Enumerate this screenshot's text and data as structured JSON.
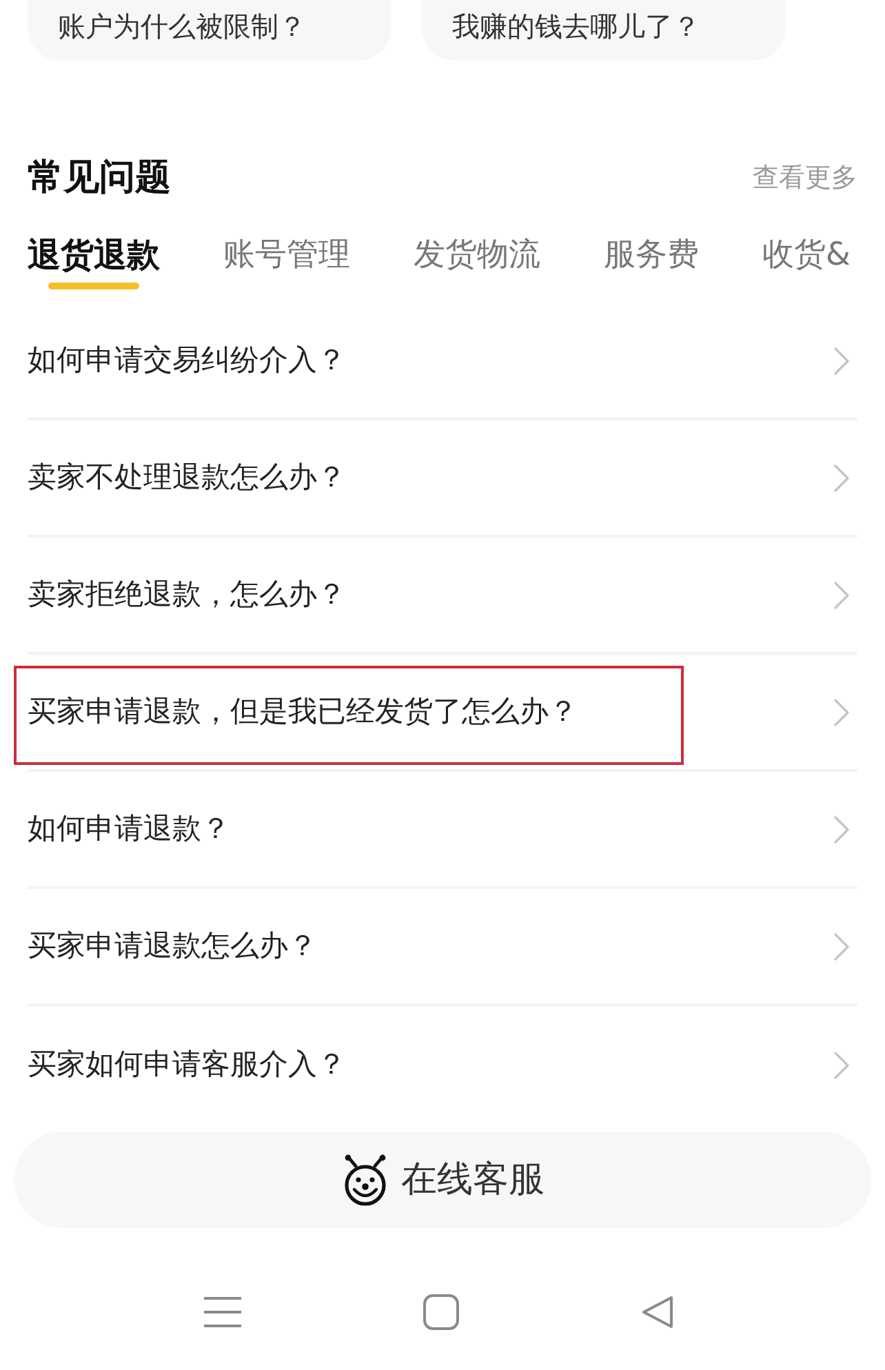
{
  "top_cards": [
    {
      "text": "账户为什么被限制？"
    },
    {
      "text": "我赚的钱去哪儿了？"
    }
  ],
  "faq": {
    "title": "常见问题",
    "more_link": "查看更多",
    "tabs": [
      {
        "label": "退货退款",
        "selected": true
      },
      {
        "label": "账号管理",
        "selected": false
      },
      {
        "label": "发货物流",
        "selected": false
      },
      {
        "label": "服务费",
        "selected": false
      },
      {
        "label": "收货&",
        "selected": false
      }
    ],
    "items": [
      {
        "text": "如何申请交易纠纷介入？",
        "highlighted": false
      },
      {
        "text": "卖家不处理退款怎么办？",
        "highlighted": false
      },
      {
        "text": "卖家拒绝退款，怎么办？",
        "highlighted": false
      },
      {
        "text": "买家申请退款，但是我已经发货了怎么办？",
        "highlighted": true
      },
      {
        "text": "如何申请退款？",
        "highlighted": false
      },
      {
        "text": "买家申请退款怎么办？",
        "highlighted": false
      },
      {
        "text": "买家如何申请客服介入？",
        "highlighted": false
      }
    ]
  },
  "support_button": {
    "label": "在线客服"
  }
}
